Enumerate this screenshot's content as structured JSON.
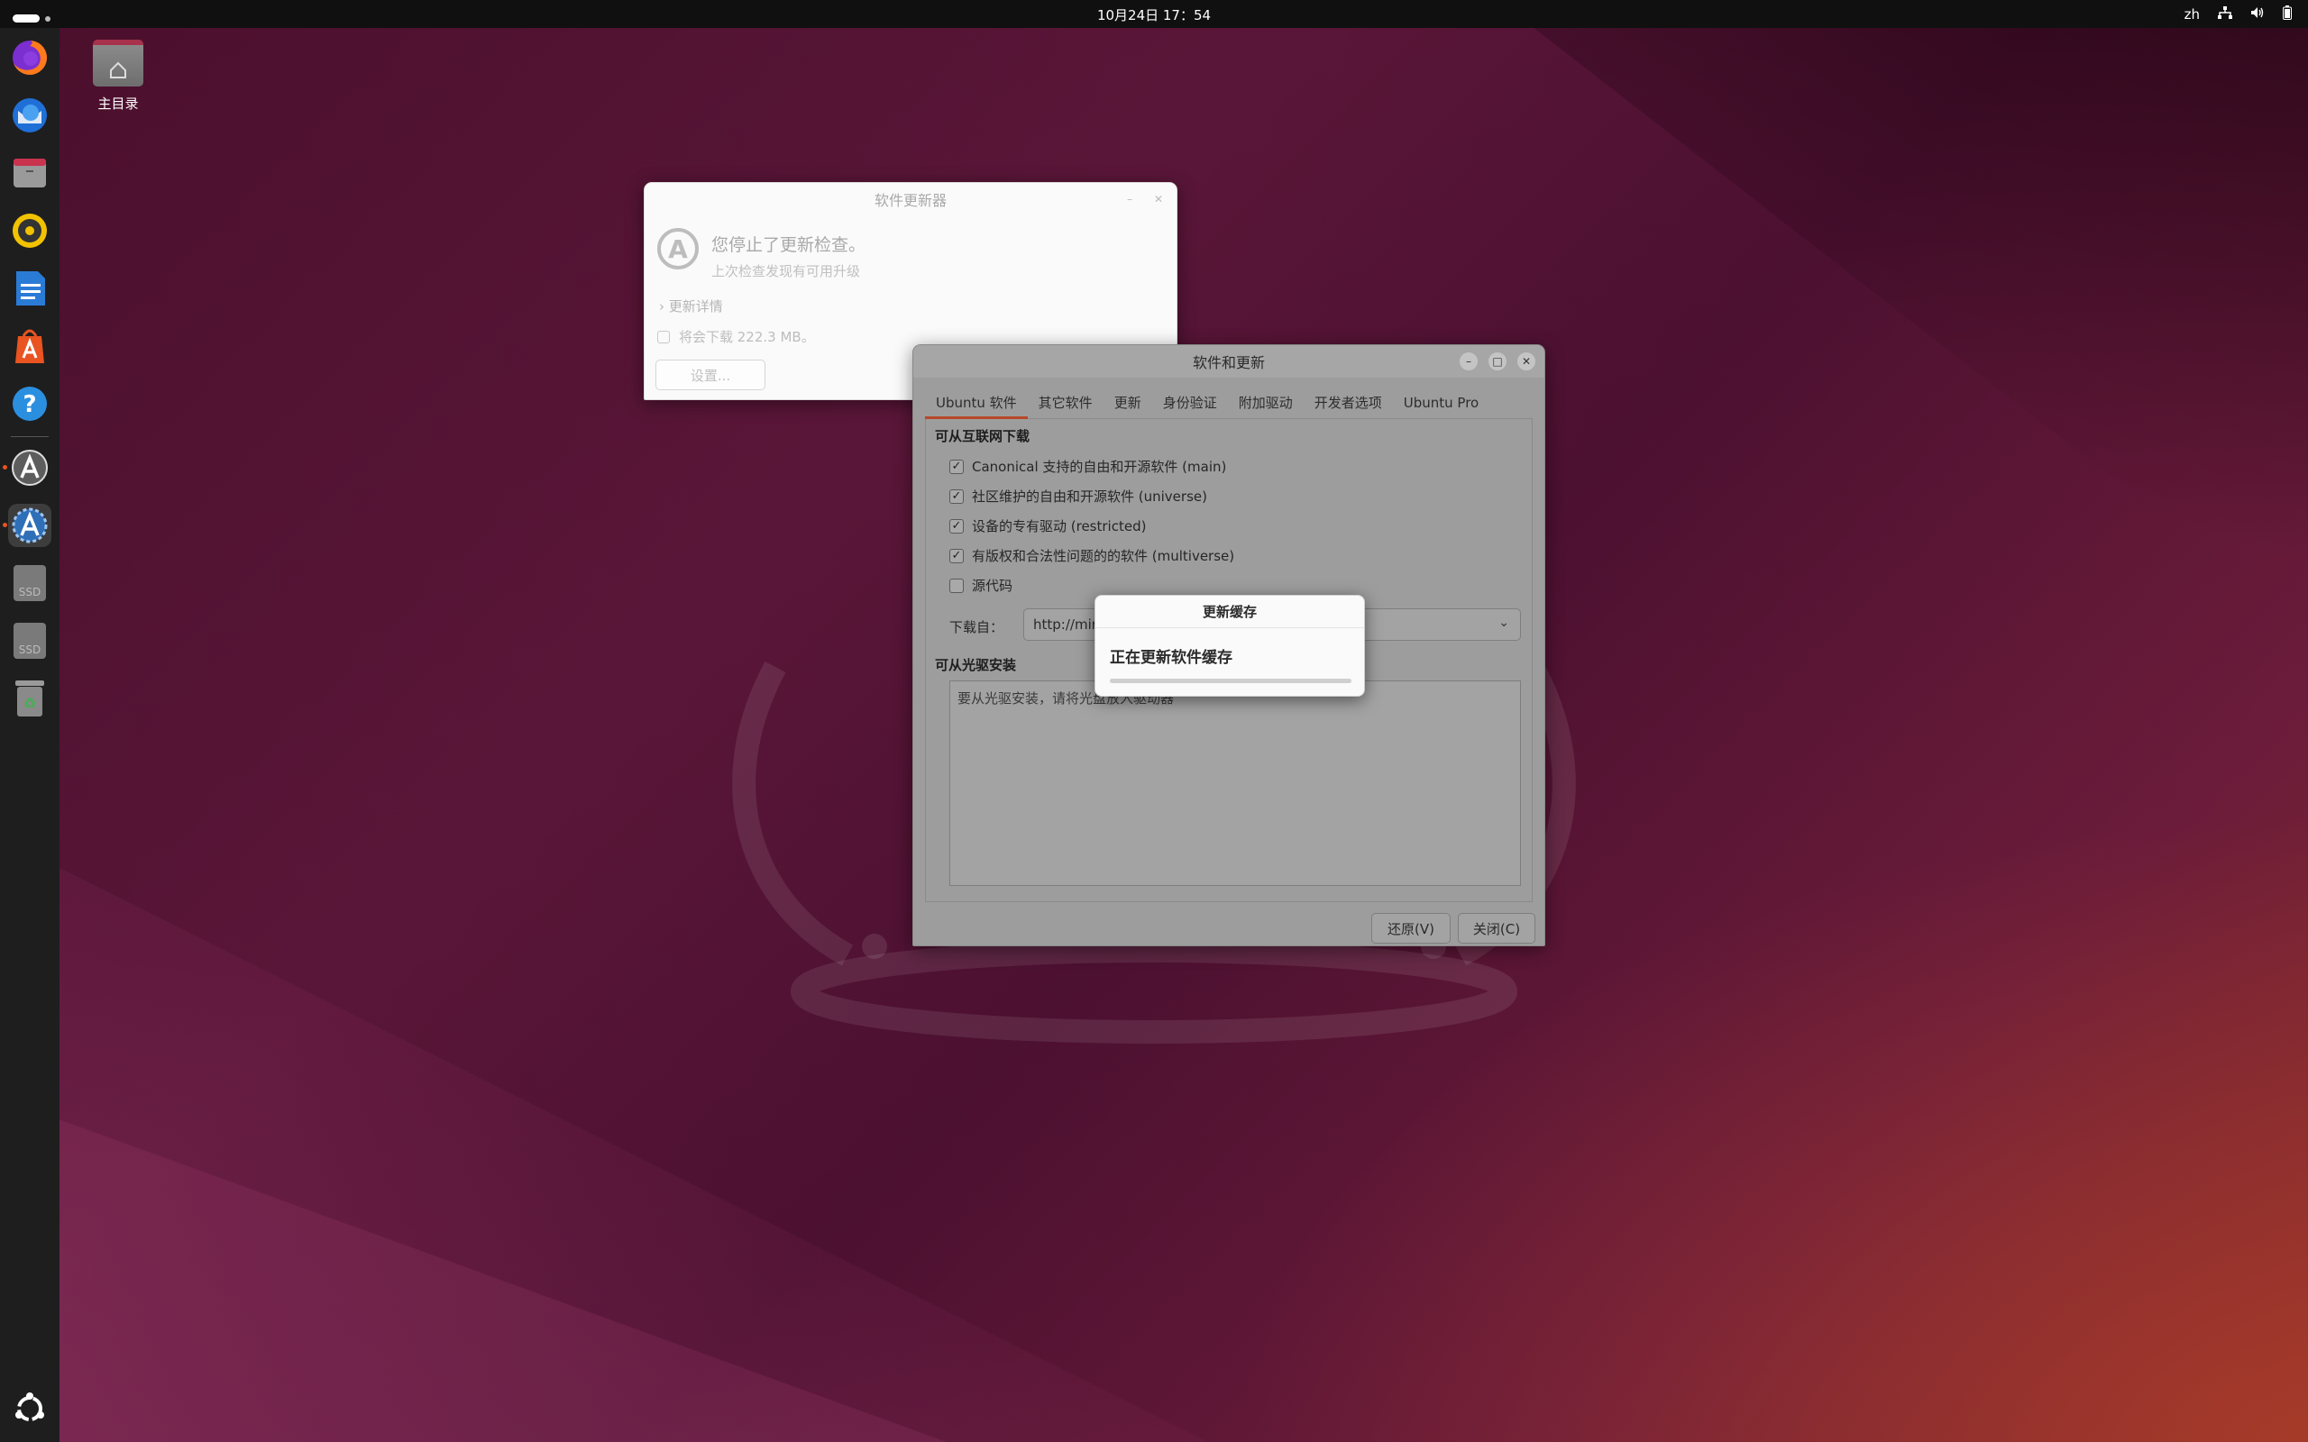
{
  "topbar": {
    "clock": "10月24日  17：54",
    "lang": "zh"
  },
  "desktop": {
    "home_label": "主目录"
  },
  "updater": {
    "title": "软件更新器",
    "status_title": "您停止了更新检查。",
    "status_sub": "上次检查发现有可用升级",
    "details": "更新详情",
    "download": "将会下载 222.3 MB。",
    "settings_label": "设置..."
  },
  "swu": {
    "title": "软件和更新",
    "tabs": [
      "Ubuntu 软件",
      "其它软件",
      "更新",
      "身份验证",
      "附加驱动",
      "开发者选项",
      "Ubuntu Pro"
    ],
    "internet_title": "可从互联网下载",
    "components": [
      {
        "label": "Canonical 支持的自由和开源软件 (main)",
        "checked": true
      },
      {
        "label": "社区维护的自由和开源软件 (universe)",
        "checked": true
      },
      {
        "label": "设备的专有驱动 (restricted)",
        "checked": true
      },
      {
        "label": "有版权和合法性问题的的软件 (multiverse)",
        "checked": true
      },
      {
        "label": "源代码",
        "checked": false
      }
    ],
    "download_from_label": "下载自：",
    "download_from_value": "http://mirr",
    "cdrom_title": "可从光驱安装",
    "cdrom_hint": "要从光驱安装，请将光盘放入驱动器",
    "revert_label": "还原(V)",
    "close_label": "关闭(C)"
  },
  "modal": {
    "title": "更新缓存",
    "message": "正在更新软件缓存",
    "progress": 1.0
  },
  "colors": {
    "accent": "#e95420"
  }
}
